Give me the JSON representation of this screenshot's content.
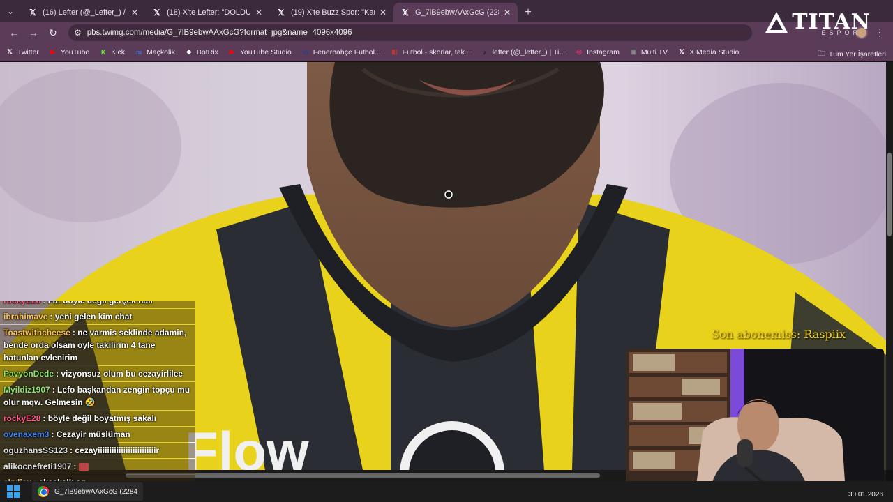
{
  "tabs": [
    {
      "title": "(16) Lefter (@_Lefter_) / X",
      "active": false
    },
    {
      "title": "(18) X'te Lefter: \"DOLDURDUM",
      "active": false
    },
    {
      "title": "(19) X'te Buzz Spor: \"Karim Ben",
      "active": false
    },
    {
      "title": "G_7lB9ebwAAxGcG (2284×3420",
      "active": true
    }
  ],
  "address": {
    "url": "pbs.twimg.com/media/G_7lB9ebwAAxGcG?format=jpg&name=4096x4096"
  },
  "bookmarks": [
    {
      "label": "Twitter",
      "icon": "x-icon",
      "color": "#ffffff"
    },
    {
      "label": "YouTube",
      "icon": "youtube-icon",
      "color": "#ff0000"
    },
    {
      "label": "Kick",
      "icon": "kick-icon",
      "color": "#53fc18"
    },
    {
      "label": "Maçkolik",
      "icon": "mackolik-icon",
      "color": "#3b6fd8"
    },
    {
      "label": "BotRix",
      "icon": "botrix-icon",
      "color": "#ffffff"
    },
    {
      "label": "YouTube Studio",
      "icon": "youtube-studio-icon",
      "color": "#ff0000"
    },
    {
      "label": "Fenerbahçe Futbol...",
      "icon": "fenerbahce-icon",
      "color": "#2b3a9a"
    },
    {
      "label": "Futbol - skorlar, tak...",
      "icon": "futbol-icon",
      "color": "#c0392b"
    },
    {
      "label": "lefter (@_lefter_) | Ti...",
      "icon": "tiktok-icon",
      "color": "#000000"
    },
    {
      "label": "Instagram",
      "icon": "instagram-icon",
      "color": "#e1306c"
    },
    {
      "label": "Multi TV",
      "icon": "multitv-icon",
      "color": "#888888"
    },
    {
      "label": "X Media Studio",
      "icon": "x-icon",
      "color": "#ffffff"
    }
  ],
  "bookmarks_all": "Tüm Yer İşaretleri",
  "overlay": {
    "logo_text": "TITAN",
    "logo_sub": "ESPOR",
    "sub_alert": "Son abonemiss: Raspiix"
  },
  "chat": [
    {
      "user": "rockyE28",
      "color": "#ff5a8a",
      "text": "Fa: böyle değil gerçek hali"
    },
    {
      "user": "ibrahimavc",
      "color": "#ffc35a",
      "text": "yeni gelen kim chat"
    },
    {
      "user": "Toastwithcheese",
      "color": "#ffc35a",
      "text": "ne varmis seklinde adamin, bende orda olsam oyle takilirim 4 tane hatunlan evlenirim"
    },
    {
      "user": "PavyonDede",
      "color": "#8fe36a",
      "text": "vizyonsuz olum bu cezayirlilee"
    },
    {
      "user": "Myildiz1907",
      "color": "#8fe36a",
      "text": "Lefo başkandan zengin topçu mu olur mqw. Gelmesin 🤣"
    },
    {
      "user": "rockyE28",
      "color": "#ff5a8a",
      "text": "böyle değil boyatmış sakalı"
    },
    {
      "user": "ovenaxem3",
      "color": "#3b82f6",
      "text": "Cezayir müslüman"
    },
    {
      "user": "oguzhansSS123",
      "color": "#dddddd",
      "text": "cezayiiiiiiiiiiiiiiiiiiiiiiiiir"
    },
    {
      "user": "alikocnefreti1907",
      "color": "#dddddd",
      "text": ""
    },
    {
      "user": "skyliex",
      "color": "#ffc35a",
      "text": "aksakallı ag"
    }
  ],
  "taskbar": {
    "app_label": "G_7lB9ebwAAxGcG (2284",
    "date": "30.01.2026"
  }
}
